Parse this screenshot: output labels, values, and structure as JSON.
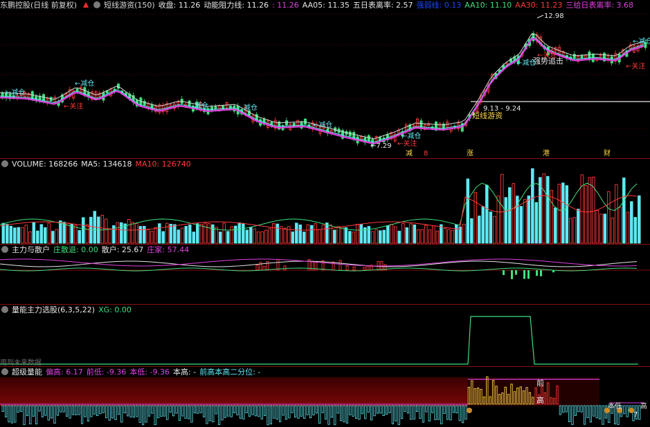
{
  "colors": {
    "up": "#ff3a3a",
    "down": "#3fe07f",
    "cyan": "#5fe8f2",
    "magenta": "#e040e0",
    "white": "#e6e6e6",
    "yellow": "#ffd84a",
    "grid": "#7a0000"
  },
  "header": {
    "stock_title": "东鹏控股(日线 前复权)",
    "formula": "短线游资(150)",
    "close": "收盘: 11.26",
    "resist": "动能阻力线: 11.26",
    "resist2": ": 11.26",
    "aa05": "AA05: 11.35",
    "ratio5": "五日表离率: 2.57",
    "hidden_label": "强弱线: 0.13",
    "aa10": "AA10: 11.10",
    "aa30": "AA30: 11.23",
    "ratio3": "三给日表离率: 3.68"
  },
  "price_labels": {
    "high": "12.98",
    "low": "←7.29",
    "range": "9.13 - 9.24",
    "youzi": "短线游资",
    "zhuishi": "强势追击",
    "reduce": "←减仓",
    "reduce2": "减仓",
    "reduce3": "←减仓",
    "reduce4": "减仓",
    "reduce5": "←减仓",
    "reduce6": "←减仓",
    "reduce7": "←减仓",
    "reduce8": "←减仓",
    "focus": "←关注",
    "focus2": "←关注",
    "focus3": "←关注",
    "focus4": "←关注",
    "m1": "减",
    "m2": "8",
    "m3": "涨",
    "m4": "港",
    "m5": "财"
  },
  "volume": {
    "title": "VOLUME: 168266",
    "ma5": "MA5: 134618",
    "ma10": "MA10: 126740"
  },
  "force": {
    "title": "主力与散户",
    "retreat": "庄散退: 0.00",
    "retail": "散户: 25.67",
    "dealer": "庄家: 57.44"
  },
  "select": {
    "title": "量能主力选股(6,3,5,22)",
    "xg": "XG: 0.00",
    "note": "用到未来数据"
  },
  "energy": {
    "title": "超级量能",
    "p1": "偏高: 6.17",
    "p2": "前低: -9.36",
    "p3": "本低: -9.36",
    "p4": "本高: -",
    "p5": "前高本高二分位: -",
    "label_qian": "前",
    "label_gao": "高",
    "label_gao2": "高",
    "label_r1": "本低",
    "label_r2": "7"
  }
}
